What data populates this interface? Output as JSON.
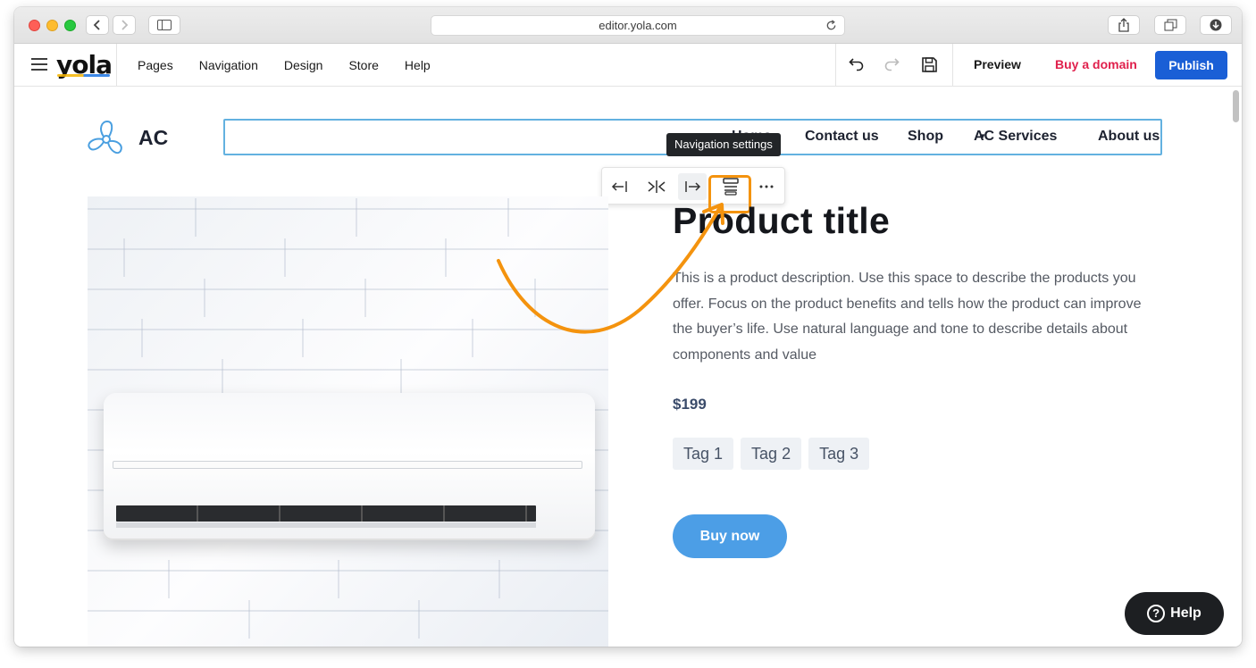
{
  "browser": {
    "url": "editor.yola.com"
  },
  "editor": {
    "logo": "yola",
    "menu": [
      "Pages",
      "Navigation",
      "Design",
      "Store",
      "Help"
    ],
    "preview_label": "Preview",
    "buy_domain_label": "Buy a domain",
    "publish_label": "Publish",
    "icons": [
      "hamburger-icon",
      "undo-icon",
      "redo-icon",
      "save-icon"
    ]
  },
  "site": {
    "name": "AC",
    "logo_icon": "fan-icon",
    "nav": {
      "items": [
        "Home",
        "Contact us",
        "Shop",
        "AC Services",
        "About us"
      ],
      "dropdown_caret": "▾"
    },
    "nav_toolbar": {
      "tooltip": "Navigation settings",
      "buttons": [
        "align-left-icon",
        "align-center-icon",
        "align-right-icon",
        "navigation-settings-icon",
        "more-icon"
      ]
    },
    "product": {
      "title": "Product title",
      "description": "This is a product description. Use this space to describe the products you offer. Focus on the product benefits and tells how the product can improve the buyer’s life. Use natural language and tone to describe details about components and value",
      "price": "$199",
      "tags": [
        "Tag 1",
        "Tag 2",
        "Tag 3"
      ],
      "buy_label": "Buy now"
    },
    "help_label": "Help"
  },
  "colors": {
    "publish": "#1a5fd6",
    "buy_domain": "#e0204c",
    "highlight": "#f4930e",
    "nav_outline": "#63b1e0",
    "buy_now": "#4c9ee6"
  }
}
